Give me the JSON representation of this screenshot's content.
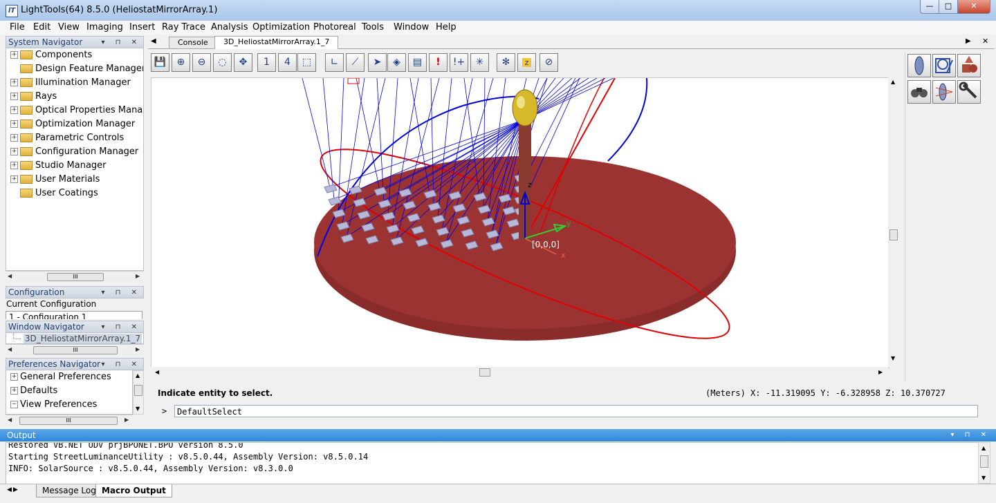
{
  "window": {
    "title": "LightTools(64) 8.5.0  (HeliostatMirrorArray.1)",
    "app_icon_text": "lT",
    "min": "—",
    "max": "□",
    "close": "✕"
  },
  "menu": [
    "File",
    "Edit",
    "View",
    "Imaging",
    "Insert",
    "Ray Trace",
    "Analysis",
    "Optimization",
    "Photoreal",
    "Tools",
    "Window",
    "Help"
  ],
  "system_navigator": {
    "title": "System Navigator",
    "items": [
      {
        "label": "Components",
        "expandable": true
      },
      {
        "label": "Design Feature Manager",
        "expandable": false
      },
      {
        "label": "Illumination Manager",
        "expandable": true
      },
      {
        "label": "Rays",
        "expandable": true
      },
      {
        "label": "Optical Properties Manage",
        "expandable": true
      },
      {
        "label": "Optimization Manager",
        "expandable": true
      },
      {
        "label": "Parametric Controls",
        "expandable": true
      },
      {
        "label": "Configuration Manager",
        "expandable": true
      },
      {
        "label": "Studio Manager",
        "expandable": true
      },
      {
        "label": "User Materials",
        "expandable": true
      },
      {
        "label": "User Coatings",
        "expandable": false
      }
    ],
    "scroll_thumb": "III"
  },
  "configuration": {
    "title": "Configuration",
    "current_label": "Current Configuration",
    "current_value": "1 - Configuration 1"
  },
  "window_navigator": {
    "title": "Window Navigator",
    "item": "3D_HeliostatMirrorArray.1_7",
    "scroll_thumb": "III"
  },
  "preferences_navigator": {
    "title": "Preferences Navigator",
    "items": [
      {
        "label": "General Preferences",
        "expander": "+"
      },
      {
        "label": "Defaults",
        "expander": "+"
      },
      {
        "label": "View Preferences",
        "expander": "−"
      }
    ],
    "scroll_thumb": "III"
  },
  "viewport_tabs": [
    "Console",
    "3D_HeliostatMirrorArray.1_7"
  ],
  "active_tab": 1,
  "toolbar": {
    "buttons": [
      {
        "name": "save-icon",
        "glyph": "💾"
      },
      {
        "name": "zoom-in-icon",
        "glyph": "⊕"
      },
      {
        "name": "zoom-out-icon",
        "glyph": "⊖"
      },
      {
        "name": "zoom-window-icon",
        "glyph": "◌"
      },
      {
        "name": "zoom-extents-icon",
        "glyph": "✥"
      },
      {
        "name": "single-view-icon",
        "glyph": "1"
      },
      {
        "name": "four-view-icon",
        "glyph": "4"
      },
      {
        "name": "cube-view-icon",
        "glyph": "⬚"
      },
      {
        "name": "axes-icon",
        "glyph": "∟"
      },
      {
        "name": "lens-ray-icon",
        "glyph": "⟋"
      },
      {
        "name": "select-arrow-icon",
        "glyph": "➤"
      },
      {
        "name": "lens-gray-icon",
        "glyph": "◈"
      },
      {
        "name": "document-icon",
        "glyph": "▤"
      },
      {
        "name": "exclamation-icon",
        "glyph": "!"
      },
      {
        "name": "exclamation-plus-icon",
        "glyph": "!+"
      },
      {
        "name": "ray-fan-icon",
        "glyph": "✳"
      },
      {
        "name": "bug-icon",
        "glyph": "✻"
      },
      {
        "name": "z-box-icon",
        "glyph": "z"
      },
      {
        "name": "lens-red-icon",
        "glyph": "⊘"
      }
    ]
  },
  "scene_labels": {
    "origin": "[0,0,0]",
    "axis_x": "x",
    "axis_y": "y",
    "axis_z": "z"
  },
  "status": {
    "prompt": "Indicate entity to select.",
    "units": "(Meters)",
    "x_label": "X:",
    "x": "-11.319095",
    "y_label": "Y:",
    "y": "-6.328958",
    "z_label": "Z:",
    "z": "10.370727"
  },
  "command": {
    "prompt": ">",
    "value": "DefaultSelect"
  },
  "output": {
    "title": "Output",
    "lines": [
      "Restored VB.NET UDV prjBPONET.BPO version 8.5.0",
      "Starting StreetLuminanceUtility : v8.5.0.44, Assembly Version: v8.5.0.14",
      "INFO: SolarSource : v8.5.0.44, Assembly Version: v8.3.0.0"
    ],
    "tabs": [
      "Message Log",
      "Macro Output"
    ],
    "active_tab": 1
  },
  "colors": {
    "ground": "#9b3333",
    "rays_blue": "#0000dd",
    "rays_red": "#e00000",
    "tower": "#8a3b31",
    "receiver": "#d6b82a"
  }
}
